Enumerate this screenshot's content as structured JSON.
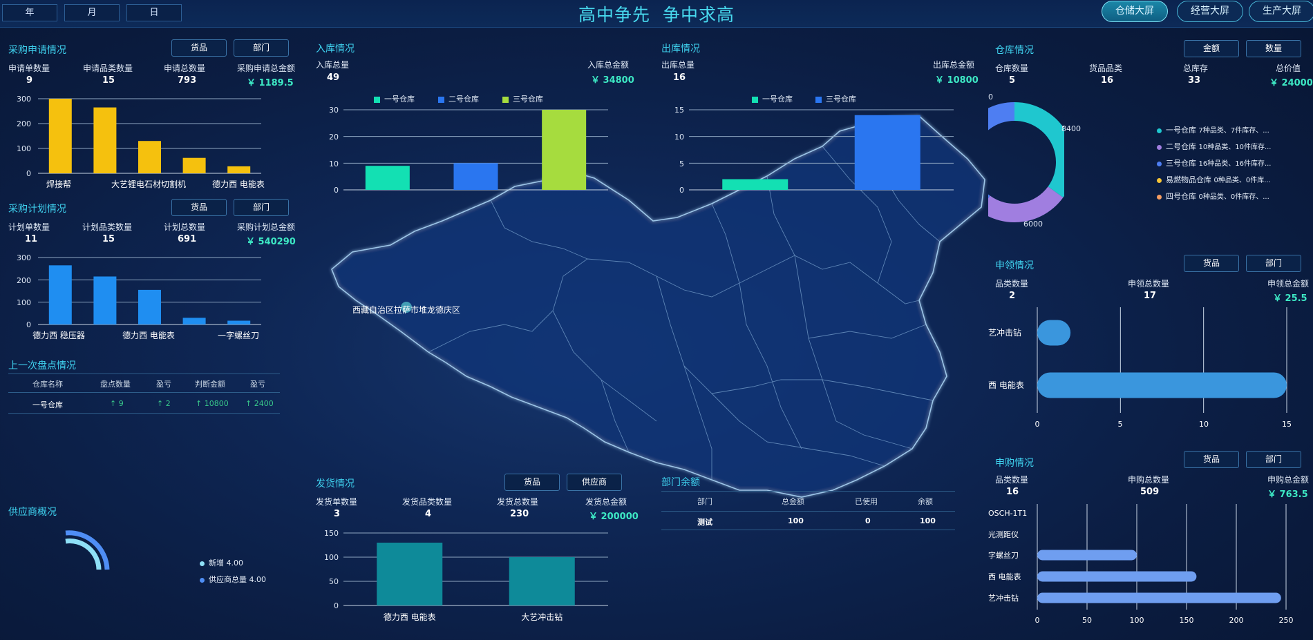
{
  "header": {
    "period_buttons": [
      "年",
      "月",
      "日"
    ],
    "title": "高中争先  争中求高",
    "screens": [
      "仓储大屏",
      "经营大屏",
      "生产大屏"
    ]
  },
  "purchase_request": {
    "title": "采购申请情况",
    "buttons": [
      "货品",
      "部门"
    ],
    "stats": [
      {
        "label": "申请单数量",
        "value": "9"
      },
      {
        "label": "申请品类数量",
        "value": "15"
      },
      {
        "label": "申请总数量",
        "value": "793"
      },
      {
        "label": "采购申请总金额",
        "value": "￥ 1189.5"
      }
    ],
    "yticks": [
      "300",
      "200",
      "100",
      "0"
    ],
    "xlabels": [
      "焊接帮",
      "大艺锂电石材切割机",
      "德力西 电能表"
    ]
  },
  "purchase_plan": {
    "title": "采购计划情况",
    "buttons": [
      "货品",
      "部门"
    ],
    "stats": [
      {
        "label": "计划单数量",
        "value": "11"
      },
      {
        "label": "计划品类数量",
        "value": "15"
      },
      {
        "label": "计划总数量",
        "value": "691"
      },
      {
        "label": "采购计划总金额",
        "value": "￥ 540290"
      }
    ],
    "yticks": [
      "300",
      "200",
      "100",
      "0"
    ],
    "xlabels": [
      "德力西 稳压器",
      "德力西 电能表",
      "一字螺丝刀"
    ]
  },
  "inventory_check": {
    "title": "上一次盘点情况",
    "headers": [
      "仓库名称",
      "盘点数量",
      "盈亏",
      "判断金额",
      "盈亏"
    ],
    "row": [
      "一号仓库",
      "↑ 9",
      "↑ 2",
      "↑ 10800",
      "↑ 2400"
    ]
  },
  "supplier": {
    "title": "供应商概况",
    "legend": [
      {
        "label": "新增 4.00",
        "color": "#8fe0f7"
      },
      {
        "label": "供应商总量 4.00",
        "color": "#4f8ef5"
      }
    ]
  },
  "inbound": {
    "title": "入库情况",
    "stats": [
      {
        "label": "入库总量",
        "value": "49"
      },
      {
        "label": "入库总金额",
        "value": "￥ 34800"
      }
    ],
    "legend": [
      "一号仓库",
      "二号仓库",
      "三号仓库"
    ],
    "yticks": [
      "30",
      "20",
      "10",
      "0"
    ]
  },
  "outbound": {
    "title": "出库情况",
    "stats": [
      {
        "label": "出库总量",
        "value": "16"
      },
      {
        "label": "出库总金额",
        "value": "￥ 10800"
      }
    ],
    "legend": [
      "一号仓库",
      "三号仓库"
    ],
    "yticks": [
      "15",
      "10",
      "5",
      "0"
    ]
  },
  "map": {
    "marker_label": "西藏自治区拉萨市堆龙德庆区"
  },
  "delivery": {
    "title": "发货情况",
    "buttons": [
      "货品",
      "供应商"
    ],
    "stats": [
      {
        "label": "发货单数量",
        "value": "3"
      },
      {
        "label": "发货品类数量",
        "value": "4"
      },
      {
        "label": "发货总数量",
        "value": "230"
      },
      {
        "label": "发货总金额",
        "value": "￥ 200000"
      }
    ],
    "yticks": [
      "150",
      "100",
      "50",
      "0"
    ]
  },
  "dept_balance": {
    "title": "部门余额",
    "headers": [
      "部门",
      "总金额",
      "已使用",
      "余额"
    ],
    "row": [
      "测试",
      "100",
      "0",
      "100"
    ]
  },
  "warehouse": {
    "title": "仓库情况",
    "buttons": [
      "金额",
      "数量"
    ],
    "stats": [
      {
        "label": "仓库数量",
        "value": "5"
      },
      {
        "label": "货品品类",
        "value": "16"
      },
      {
        "label": "总库存",
        "value": "33"
      },
      {
        "label": "总价值",
        "value": "￥ 24000"
      }
    ],
    "donut_labels": [
      "8400",
      "6000",
      "0"
    ],
    "legend": [
      {
        "name": "一号仓库",
        "detail": "7种品类、7件库存、...",
        "color": "#1fc7cf"
      },
      {
        "name": "二号仓库",
        "detail": "10种品类、10件库存...",
        "color": "#a07ee0"
      },
      {
        "name": "三号仓库",
        "detail": "16种品类、16件库存...",
        "color": "#4e7ef2"
      },
      {
        "name": "易燃物品仓库",
        "detail": "0种品类、0件库...",
        "color": "#f5c437"
      },
      {
        "name": "四号仓库",
        "detail": "0种品类、0件库存、...",
        "color": "#f59d62"
      }
    ]
  },
  "requisition": {
    "title": "申领情况",
    "buttons": [
      "货品",
      "部门"
    ],
    "stats": [
      {
        "label": "品类数量",
        "value": "2"
      },
      {
        "label": "申领总数量",
        "value": "17"
      },
      {
        "label": "申领总金额",
        "value": "￥ 25.5"
      }
    ],
    "ylabels": [
      "艺冲击钻",
      "西 电能表"
    ],
    "xticks": [
      "0",
      "5",
      "10",
      "15"
    ]
  },
  "apply_purchase": {
    "title": "申购情况",
    "buttons": [
      "货品",
      "部门"
    ],
    "stats": [
      {
        "label": "品类数量",
        "value": "16"
      },
      {
        "label": "申购总数量",
        "value": "509"
      },
      {
        "label": "申购总金额",
        "value": "￥ 763.5"
      }
    ],
    "ylabels": [
      "OSCH-1T1",
      "光测距仪",
      "字螺丝刀",
      "西 电能表",
      "艺冲击钻"
    ],
    "xticks": [
      "0",
      "50",
      "100",
      "150",
      "200",
      "250"
    ]
  },
  "chart_data": [
    {
      "type": "bar",
      "title": "采购申请情况",
      "categories": [
        "焊接帮",
        "",
        "大艺锂电石材切割机",
        "",
        "德力西 电能表"
      ],
      "values": [
        300,
        265,
        130,
        62,
        28
      ],
      "ylim": [
        0,
        300
      ],
      "color": "#f5c10e"
    },
    {
      "type": "bar",
      "title": "采购计划情况",
      "categories": [
        "德力西 稳压器",
        "",
        "德力西 电能表",
        "",
        "一字螺丝刀"
      ],
      "values": [
        265,
        215,
        155,
        30,
        17
      ],
      "ylim": [
        0,
        300
      ],
      "color": "#1f8ef1"
    },
    {
      "type": "bar",
      "title": "入库情况",
      "categories": [
        "一号仓库",
        "二号仓库",
        "三号仓库"
      ],
      "values": [
        9,
        10,
        30
      ],
      "ylim": [
        0,
        30
      ],
      "colors": [
        "#13e0b3",
        "#2a76f0",
        "#a6dc3e"
      ]
    },
    {
      "type": "bar",
      "title": "出库情况",
      "categories": [
        "一号仓库",
        "三号仓库"
      ],
      "values": [
        2,
        14
      ],
      "ylim": [
        0,
        15
      ],
      "colors": [
        "#13e0b3",
        "#2a76f0"
      ]
    },
    {
      "type": "bar",
      "title": "发货情况",
      "categories": [
        "德力西 电能表",
        "大艺冲击钻"
      ],
      "values": [
        130,
        100
      ],
      "ylim": [
        0,
        150
      ],
      "color": "#0e8a99"
    },
    {
      "type": "pie",
      "title": "仓库情况",
      "categories": [
        "一号仓库",
        "二号仓库",
        "三号仓库",
        "易燃物品仓库",
        "四号仓库"
      ],
      "values": [
        8400,
        6000,
        9600,
        0,
        0
      ]
    },
    {
      "type": "bar",
      "title": "申领情况",
      "categories": [
        "艺冲击钻",
        "西 电能表"
      ],
      "values": [
        2,
        15
      ],
      "xlim": [
        0,
        15
      ],
      "color": "#3a96dd"
    },
    {
      "type": "bar",
      "title": "申购情况",
      "categories": [
        "OSCH-1T1",
        "光测距仪",
        "字螺丝刀",
        "西 电能表",
        "艺冲击钻"
      ],
      "values": [
        0,
        0,
        100,
        160,
        245
      ],
      "xlim": [
        0,
        250
      ],
      "color": "#6f9ef0"
    }
  ]
}
